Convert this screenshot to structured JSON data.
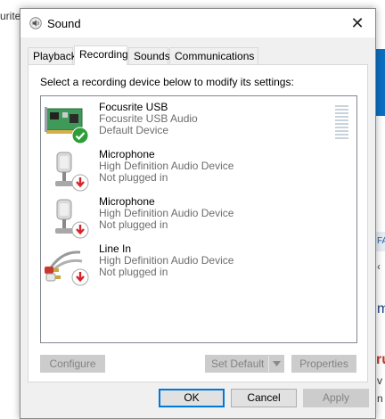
{
  "background": {
    "partial_text_left": "urite",
    "partial_text_mid": "FA",
    "partial_text_red": "ru",
    "partial_text_m": "m",
    "partial_text_v": "v",
    "partial_text_n": "n",
    "partial_chevron": "‹"
  },
  "window": {
    "title": "Sound",
    "close_glyph": "✕"
  },
  "tabs": [
    {
      "label": "Playback",
      "active": false
    },
    {
      "label": "Recording",
      "active": true
    },
    {
      "label": "Sounds",
      "active": false
    },
    {
      "label": "Communications",
      "active": false
    }
  ],
  "instruction": "Select a recording device below to modify its settings:",
  "devices": [
    {
      "name": "Focusrite USB",
      "description": "Focusrite USB Audio",
      "status": "Default Device",
      "icon": "sound-card-icon",
      "badge": "default-check-icon"
    },
    {
      "name": "Microphone",
      "description": "High Definition Audio Device",
      "status": "Not plugged in",
      "icon": "microphone-icon",
      "badge": "unplugged-arrow-icon"
    },
    {
      "name": "Microphone",
      "description": "High Definition Audio Device",
      "status": "Not plugged in",
      "icon": "microphone-icon",
      "badge": "unplugged-arrow-icon"
    },
    {
      "name": "Line In",
      "description": "High Definition Audio Device",
      "status": "Not plugged in",
      "icon": "line-in-cable-icon",
      "badge": "unplugged-arrow-icon"
    }
  ],
  "buttons": {
    "configure": "Configure",
    "set_default": "Set Default",
    "properties": "Properties",
    "ok": "OK",
    "cancel": "Cancel",
    "apply": "Apply"
  },
  "colors": {
    "accent": "#0078d7",
    "check_green": "#2e9e3a",
    "unplugged_red": "#d8232a"
  }
}
